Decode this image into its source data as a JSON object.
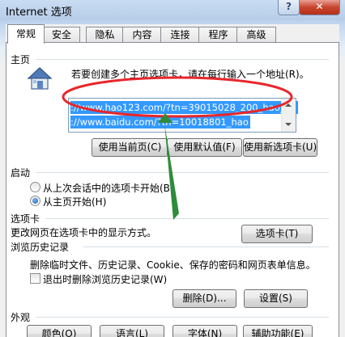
{
  "window": {
    "title": "Internet 选项",
    "help": "?",
    "close": "✕"
  },
  "tabs": [
    {
      "label": "常规",
      "active": true
    },
    {
      "label": "安全"
    },
    {
      "label": "隐私"
    },
    {
      "label": "内容"
    },
    {
      "label": "连接"
    },
    {
      "label": "程序"
    },
    {
      "label": "高级"
    }
  ],
  "home": {
    "group": "主页",
    "hint": "若要创建多个主页选项卡，请在每行输入一个地址(R)。",
    "urls": [
      "://www.hao123.com/?tn=39015028_200_hao_pg",
      "://www.baidu.com/?tn=10018801_hao"
    ],
    "btn_current": "使用当前页(C)",
    "btn_default": "使用默认值(F)",
    "btn_newtab": "使用新选项卡(U)"
  },
  "startup": {
    "group": "启动",
    "opt_last": "从上次会话中的选项卡开始(B)",
    "opt_home": "从主页开始(H)"
  },
  "tabsection": {
    "group": "选项卡",
    "desc": "更改网页在选项卡中的显示方式。",
    "btn": "选项卡(T)"
  },
  "history": {
    "group": "浏览历史记录",
    "desc": "删除临时文件、历史记录、Cookie、保存的密码和网页表单信息。",
    "checkbox": "退出时删除浏览历史记录(W)",
    "btn_delete": "删除(D)...",
    "btn_settings": "设置(S)"
  },
  "appearance": {
    "group": "外观",
    "btn_colors": "颜色(O)",
    "btn_languages": "语言(L)",
    "btn_fonts": "字体(N)",
    "btn_accessibility": "辅助功能(E)"
  },
  "colors": {
    "annotation": "#e8262b",
    "arrow": "#2e8b3a",
    "selection": "#3399ff"
  }
}
